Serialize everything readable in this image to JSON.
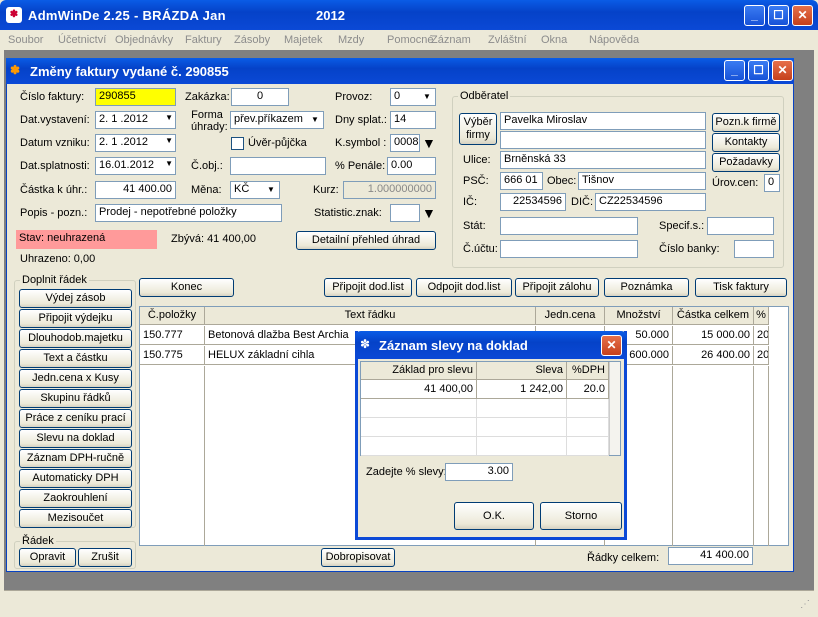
{
  "app": {
    "title": "AdmWinDe 2.25 - BRÁZDA Jan",
    "year": "2012"
  },
  "menu": [
    "Soubor",
    "Účetnictví",
    "Objednávky",
    "Faktury",
    "Zásoby",
    "Majetek",
    "Mzdy",
    "Pomocné",
    "Záznam",
    "Zvláštní",
    "Okna",
    "Nápověda"
  ],
  "window": {
    "title": "Změny faktury vydané č. 290855"
  },
  "form": {
    "cislo_faktury_label": "Číslo faktury:",
    "cislo_faktury": "290855",
    "zakazka_label": "Zakázka:",
    "zakazka": "0",
    "provoz_label": "Provoz:",
    "provoz": "0",
    "dat_vystaveni_label": "Dat.vystavení:",
    "dat_vystaveni": "2. 1 .2012",
    "forma_label": "Forma úhrady:",
    "forma": "přev.příkazem",
    "dny_splat_label": "Dny splat.:",
    "dny_splat": "14",
    "datum_vzniku_label": "Datum vzniku:",
    "datum_vzniku": "2. 1 .2012",
    "uver_label": "Úvěr-půjčka",
    "ksymbol_label": "K.symbol :",
    "ksymbol": "0008",
    "dat_splatnosti_label": "Dat.splatnosti:",
    "dat_splatnosti": "16.01.2012",
    "cobj_label": "Č.obj.:",
    "cobj": "",
    "penale_label": "% Penále:",
    "penale": "0.00",
    "castka_label": "Částka k úhr.:",
    "castka": "41 400.00",
    "mena_label": "Měna:",
    "mena": "KČ",
    "kurz_label": "Kurz:",
    "kurz": "1.000000000",
    "popis_label": "Popis - pozn.:",
    "popis": "Prodej - nepotřebné položky",
    "statznak_label": "Statistic.znak:",
    "statznak": "",
    "stav": "Stav: neuhrazená",
    "zbyva": "Zbývá: 41 400,00",
    "prehled_btn": "Detailní přehled úhrad",
    "uhrazeno": "Uhrazeno: 0,00"
  },
  "odberatel": {
    "group_label": "Odběratel",
    "vyber_btn": "Výběr firmy",
    "name": "Pavelka Miroslav",
    "ulice_label": "Ulice:",
    "ulice": "Brněnská 33",
    "psc_label": "PSČ:",
    "psc": "666 01",
    "obec_label": "Obec:",
    "obec": "Tišnov",
    "ic_label": "IČ:",
    "ic": "22534596",
    "dic_label": "DIČ:",
    "dic": "CZ22534596",
    "stat_label": "Stát:",
    "stat": "",
    "specif_label": "Specif.s.:",
    "specif": "",
    "ucet_label": "Č.účtu:",
    "ucet": "",
    "banka_label": "Číslo banky:",
    "banka": "",
    "uroven_label": "Úrov.cen:",
    "uroven": "0",
    "pozn_btn": "Pozn.k firmě",
    "kontakty_btn": "Kontakty",
    "pozadavky_btn": "Požadavky"
  },
  "doplnit": {
    "label": "Doplnit řádek",
    "items": [
      "Výdej zásob",
      "Připojit výdejku",
      "Dlouhodob.majetku",
      "Text a částku",
      "Jedn.cena x Kusy",
      "Skupinu řádků",
      "Práce z ceníku prací",
      "Slevu na doklad",
      "Záznam DPH-ručně",
      "Automaticky DPH",
      "Zaokrouhlení",
      "Mezisoučet"
    ]
  },
  "radek": {
    "label": "Řádek",
    "opravit": "Opravit",
    "zrusit": "Zrušit"
  },
  "toolbar": {
    "konec": "Konec",
    "pripojit_dl": "Připojit dod.list",
    "odpojit_dl": "Odpojit dod.list",
    "pripojit_zal": "Připojit zálohu",
    "poznamka": "Poznámka",
    "tisk": "Tisk faktury"
  },
  "table": {
    "headers": [
      "Č.položky",
      "Text řádku",
      "Jedn.cena",
      "Množství",
      "Částka celkem",
      "%"
    ],
    "rows": [
      [
        "150.777",
        "Betonová dlažba Best Archia",
        "",
        "50.000",
        "15 000.00",
        "20"
      ],
      [
        "150.775",
        "HELUX základní cihla",
        "",
        "600.000",
        "26 400.00",
        "20"
      ]
    ]
  },
  "footer": {
    "dobropisovat": "Dobropisovat",
    "radky_celkem_label": "Řádky celkem:",
    "radky_celkem": "41 400.00"
  },
  "dialog": {
    "title": "Záznam slevy na doklad",
    "headers": [
      "Základ pro slevu",
      "Sleva",
      "%DPH"
    ],
    "row": [
      "41 400,00",
      "1 242,00",
      "20.0"
    ],
    "zadejte_label": "Zadejte % slevy:",
    "zadejte": "3.00",
    "ok": "O.K.",
    "storno": "Storno"
  }
}
